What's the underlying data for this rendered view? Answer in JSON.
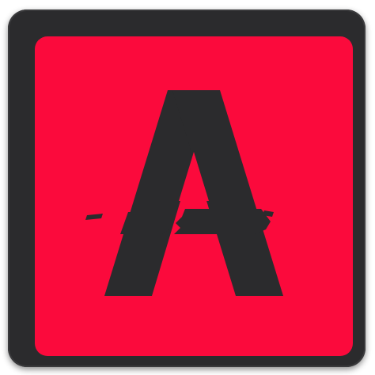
{
  "app_icon": {
    "name": "app-icon",
    "glyph_letter": "A",
    "colors": {
      "frame": "#2b2b2d",
      "face": "#fb0a3c",
      "glyph": "#2b2b2d"
    }
  }
}
